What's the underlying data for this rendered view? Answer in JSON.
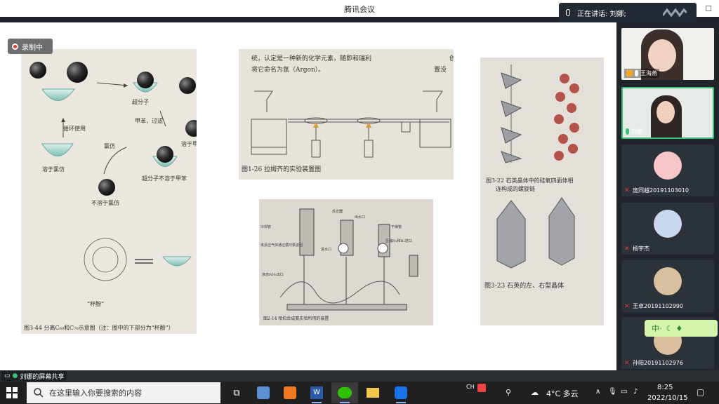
{
  "window": {
    "title": "腾讯会议"
  },
  "speaking": {
    "label": "正在讲话: 刘娜;"
  },
  "recording": {
    "label": "录制中"
  },
  "slides": {
    "p1": {
      "labels": {
        "super": "超分子",
        "toluene_filter": "甲苯，过滤",
        "recycle": "循环使用",
        "chloroform": "氯仿",
        "soluble_toluene": "溶于甲苯",
        "dissolve_chloroform": "溶于氯仿",
        "super_insoluble_toluene": "超分子不溶于甲苯",
        "insoluble_chloroform": "不溶于氯仿",
        "cup": "“杯酚”"
      },
      "caption": "图3-44   分离C₆₀和C₇₀示意图（注：图中的下部分为“杯酚”）"
    },
    "p2": {
      "text_line1": "统，认定是一种新的化学元素，随即和瑞利",
      "text_line2": "将它命名为氩（Argon）。",
      "text_right1": "创",
      "text_right2": "置没",
      "caption": "图1-26   拉姆齐的实验装置图"
    },
    "p3": {
      "labels": {
        "reactor": "反应器",
        "outlet": "出水口",
        "cooler": "冷却管",
        "dryer": "干燥管",
        "inlet": "进水口",
        "unreacted": "未反应气体通过循环泵返回",
        "pressure": "压缩N₂和H₂进口",
        "nh3_out": "液态NH₃出口"
      },
      "caption": "图2-14   哈伯合成氨实验所用的装置"
    },
    "p4": {
      "caption1": "图3-22   石英晶体中的硅氧四面体相",
      "caption1b": "连构成的螺旋链",
      "caption2": "图3-23   石英的左、右型晶体"
    }
  },
  "participants": [
    {
      "name": "王海燕",
      "active": false
    },
    {
      "name": "刘娜",
      "active": true
    },
    {
      "name": "庞同越20191103010",
      "active": false
    },
    {
      "name": "杨宇杰",
      "active": false
    },
    {
      "name": "王卓20191102990",
      "active": false
    },
    {
      "name": "孙阳20191102976",
      "active": false
    }
  ],
  "bubble": {
    "text": "中·"
  },
  "sharebar": {
    "label": "刘娜的屏幕共享"
  },
  "taskbar": {
    "search_placeholder": "在这里输入你要搜索的内容",
    "lang": "CH",
    "weather": "4°C 多云",
    "time": "8:25",
    "date": "2022/10/15"
  }
}
